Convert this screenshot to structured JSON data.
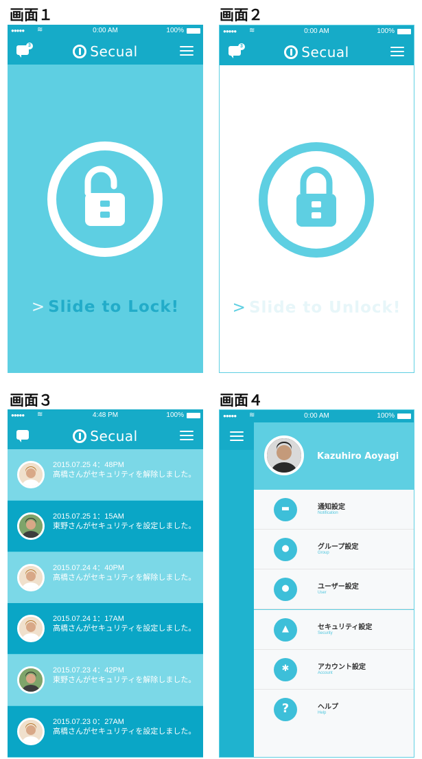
{
  "labels": [
    "画面１",
    "画面２",
    "画面３",
    "画面４"
  ],
  "status": {
    "time_default": "0:00 AM",
    "time_history": "4:48 PM",
    "battery": "100%",
    "signal": "●●●●●",
    "wifi": "WiFi"
  },
  "brand": {
    "name": "Secual"
  },
  "screen1": {
    "badge": "3",
    "slide_text": "Slide to Lock!",
    "chevron": ">"
  },
  "screen2": {
    "badge": "3",
    "slide_text": "Slide to Unlock!",
    "chevron": ">"
  },
  "screen3": {
    "entries": [
      {
        "date": "2015.07.25  4：48PM",
        "message": "高橋さんがセキュリティを解除しました。"
      },
      {
        "date": "2015.07.25  1：15AM",
        "message": "東野さんがセキュリティを設定しました。"
      },
      {
        "date": "2015.07.24  4：40PM",
        "message": "高橋さんがセキュリティを解除しました。"
      },
      {
        "date": "2015.07.24  1：17AM",
        "message": "高橋さんがセキュリティを設定しました。"
      },
      {
        "date": "2015.07.23  4：42PM",
        "message": "東野さんがセキュリティを解除しました。"
      },
      {
        "date": "2015.07.23  0：27AM",
        "message": "高橋さんがセキュリティを設定しました。"
      }
    ]
  },
  "screen4": {
    "user_name": "Kazuhiro Aoyagi",
    "items": [
      {
        "title": "通知設定",
        "subtitle": "Notification",
        "icon": "chat-icon"
      },
      {
        "title": "グループ設定",
        "subtitle": "Group",
        "icon": "group-icon"
      },
      {
        "title": "ユーザー設定",
        "subtitle": "User",
        "icon": "user-icon"
      },
      {
        "title": "セキュリティ設定",
        "subtitle": "Security",
        "icon": "lock-icon"
      },
      {
        "title": "アカウント設定",
        "subtitle": "Account",
        "icon": "gear-icon"
      },
      {
        "title": "ヘルプ",
        "subtitle": "Help",
        "icon": "question-icon"
      }
    ]
  },
  "colors": {
    "accent": "#1fb3cf",
    "accent_dark": "#0aa6c6",
    "light": "#5ecfe2",
    "light_alt": "#7bd8e7"
  }
}
